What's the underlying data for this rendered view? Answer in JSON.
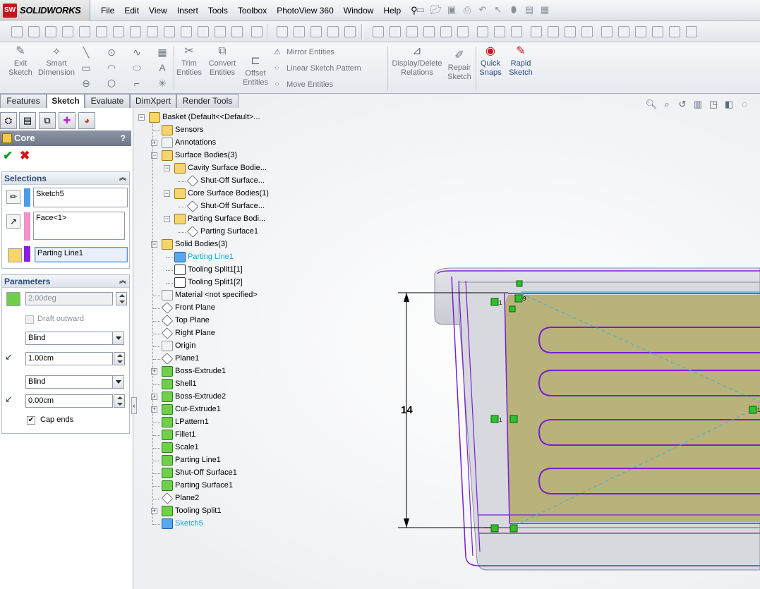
{
  "app": {
    "logo_text": "SOLIDWORKS",
    "logo_badge": "SW"
  },
  "menu": [
    "File",
    "Edit",
    "View",
    "Insert",
    "Tools",
    "Toolbox",
    "PhotoView 360",
    "Window",
    "Help"
  ],
  "command_manager": {
    "exit_sketch": "Exit\nSketch",
    "smart_dimension": "Smart\nDimension",
    "trim_entities": "Trim\nEntities",
    "convert_entities": "Convert\nEntities",
    "offset_entities": "Offset\nEntities",
    "mirror_entities": "Mirror Entities",
    "linear_sketch_pattern": "Linear Sketch Pattern",
    "move_entities": "Move Entities",
    "display_delete_relations": "Display/Delete\nRelations",
    "repair_sketch": "Repair\nSketch",
    "quick_snaps": "Quick\nSnaps",
    "rapid_sketch": "Rapid\nSketch"
  },
  "tabs": [
    "Features",
    "Sketch",
    "Evaluate",
    "DimXpert",
    "Render Tools"
  ],
  "active_tab": "Sketch",
  "property_manager": {
    "title": "Core",
    "help": "?",
    "selections": {
      "heading": "Selections",
      "sketch": "Sketch5",
      "face": "Face<1>",
      "parting_line": "Parting Line1"
    },
    "parameters": {
      "heading": "Parameters",
      "draft_angle": "2.00deg",
      "draft_outward": "Draft outward",
      "end_condition_1": "Blind",
      "depth_1": "1.00cm",
      "end_condition_2": "Blind",
      "depth_2": "0.00cm",
      "cap_ends": "Cap ends",
      "cap_ends_checked": true,
      "draft_outward_checked": false
    }
  },
  "feature_tree": [
    {
      "label": "Basket  (Default<<Default>...",
      "level": 0,
      "icon": "part",
      "expander": "-"
    },
    {
      "label": "Sensors",
      "level": 1,
      "icon": "folder",
      "expander": ""
    },
    {
      "label": "Annotations",
      "level": 1,
      "icon": "annotation",
      "expander": "+"
    },
    {
      "label": "Surface Bodies(3)",
      "level": 1,
      "icon": "folder",
      "expander": "-"
    },
    {
      "label": "Cavity Surface Bodie...",
      "level": 2,
      "icon": "folder",
      "expander": "-"
    },
    {
      "label": "Shut-Off Surface...",
      "level": 3,
      "icon": "surface",
      "expander": ""
    },
    {
      "label": "Core Surface Bodies(1)",
      "level": 2,
      "icon": "folder",
      "expander": "-"
    },
    {
      "label": "Shut-Off Surface...",
      "level": 3,
      "icon": "surface",
      "expander": ""
    },
    {
      "label": "Parting Surface Bodi...",
      "level": 2,
      "icon": "folder",
      "expander": "-"
    },
    {
      "label": "Parting Surface1",
      "level": 3,
      "icon": "surface",
      "expander": ""
    },
    {
      "label": "Solid Bodies(3)",
      "level": 1,
      "icon": "folder",
      "expander": "-"
    },
    {
      "label": "Parting Line1",
      "level": 2,
      "icon": "blue",
      "expander": "",
      "highlight": true
    },
    {
      "label": "Tooling Split1[1]",
      "level": 2,
      "icon": "solid",
      "expander": ""
    },
    {
      "label": "Tooling Split1[2]",
      "level": 2,
      "icon": "solid",
      "expander": ""
    },
    {
      "label": "Material <not specified>",
      "level": 1,
      "icon": "material",
      "expander": ""
    },
    {
      "label": "Front Plane",
      "level": 1,
      "icon": "plane",
      "expander": ""
    },
    {
      "label": "Top Plane",
      "level": 1,
      "icon": "plane",
      "expander": ""
    },
    {
      "label": "Right Plane",
      "level": 1,
      "icon": "plane",
      "expander": ""
    },
    {
      "label": "Origin",
      "level": 1,
      "icon": "origin",
      "expander": ""
    },
    {
      "label": "Plane1",
      "level": 1,
      "icon": "plane",
      "expander": ""
    },
    {
      "label": "Boss-Extrude1",
      "level": 1,
      "icon": "feat",
      "expander": "+"
    },
    {
      "label": "Shell1",
      "level": 1,
      "icon": "feat",
      "expander": ""
    },
    {
      "label": "Boss-Extrude2",
      "level": 1,
      "icon": "feat",
      "expander": "+"
    },
    {
      "label": "Cut-Extrude1",
      "level": 1,
      "icon": "feat",
      "expander": "+"
    },
    {
      "label": "LPattern1",
      "level": 1,
      "icon": "pattern",
      "expander": ""
    },
    {
      "label": "Fillet1",
      "level": 1,
      "icon": "feat",
      "expander": ""
    },
    {
      "label": "Scale1",
      "level": 1,
      "icon": "feat",
      "expander": ""
    },
    {
      "label": "Parting Line1",
      "level": 1,
      "icon": "feat",
      "expander": ""
    },
    {
      "label": "Shut-Off Surface1",
      "level": 1,
      "icon": "feat",
      "expander": ""
    },
    {
      "label": "Parting Surface1",
      "level": 1,
      "icon": "feat",
      "expander": ""
    },
    {
      "label": "Plane2",
      "level": 1,
      "icon": "plane",
      "expander": ""
    },
    {
      "label": "Tooling Split1",
      "level": 1,
      "icon": "feat",
      "expander": "+"
    },
    {
      "label": "Sketch5",
      "level": 1,
      "icon": "sketch",
      "expander": "",
      "highlight": true
    }
  ],
  "graphics": {
    "dimension_value": "14",
    "relation_marks": [
      "1",
      "1",
      "9",
      "1"
    ]
  },
  "colors": {
    "sketch_highlight": "#18a9d6",
    "model_outline": "#7a1fd6",
    "core_face": "#b9b27a",
    "selection_purple": "#8a1fe0",
    "selection_pink": "#f291c4",
    "selection_blue": "#4a9be8"
  }
}
